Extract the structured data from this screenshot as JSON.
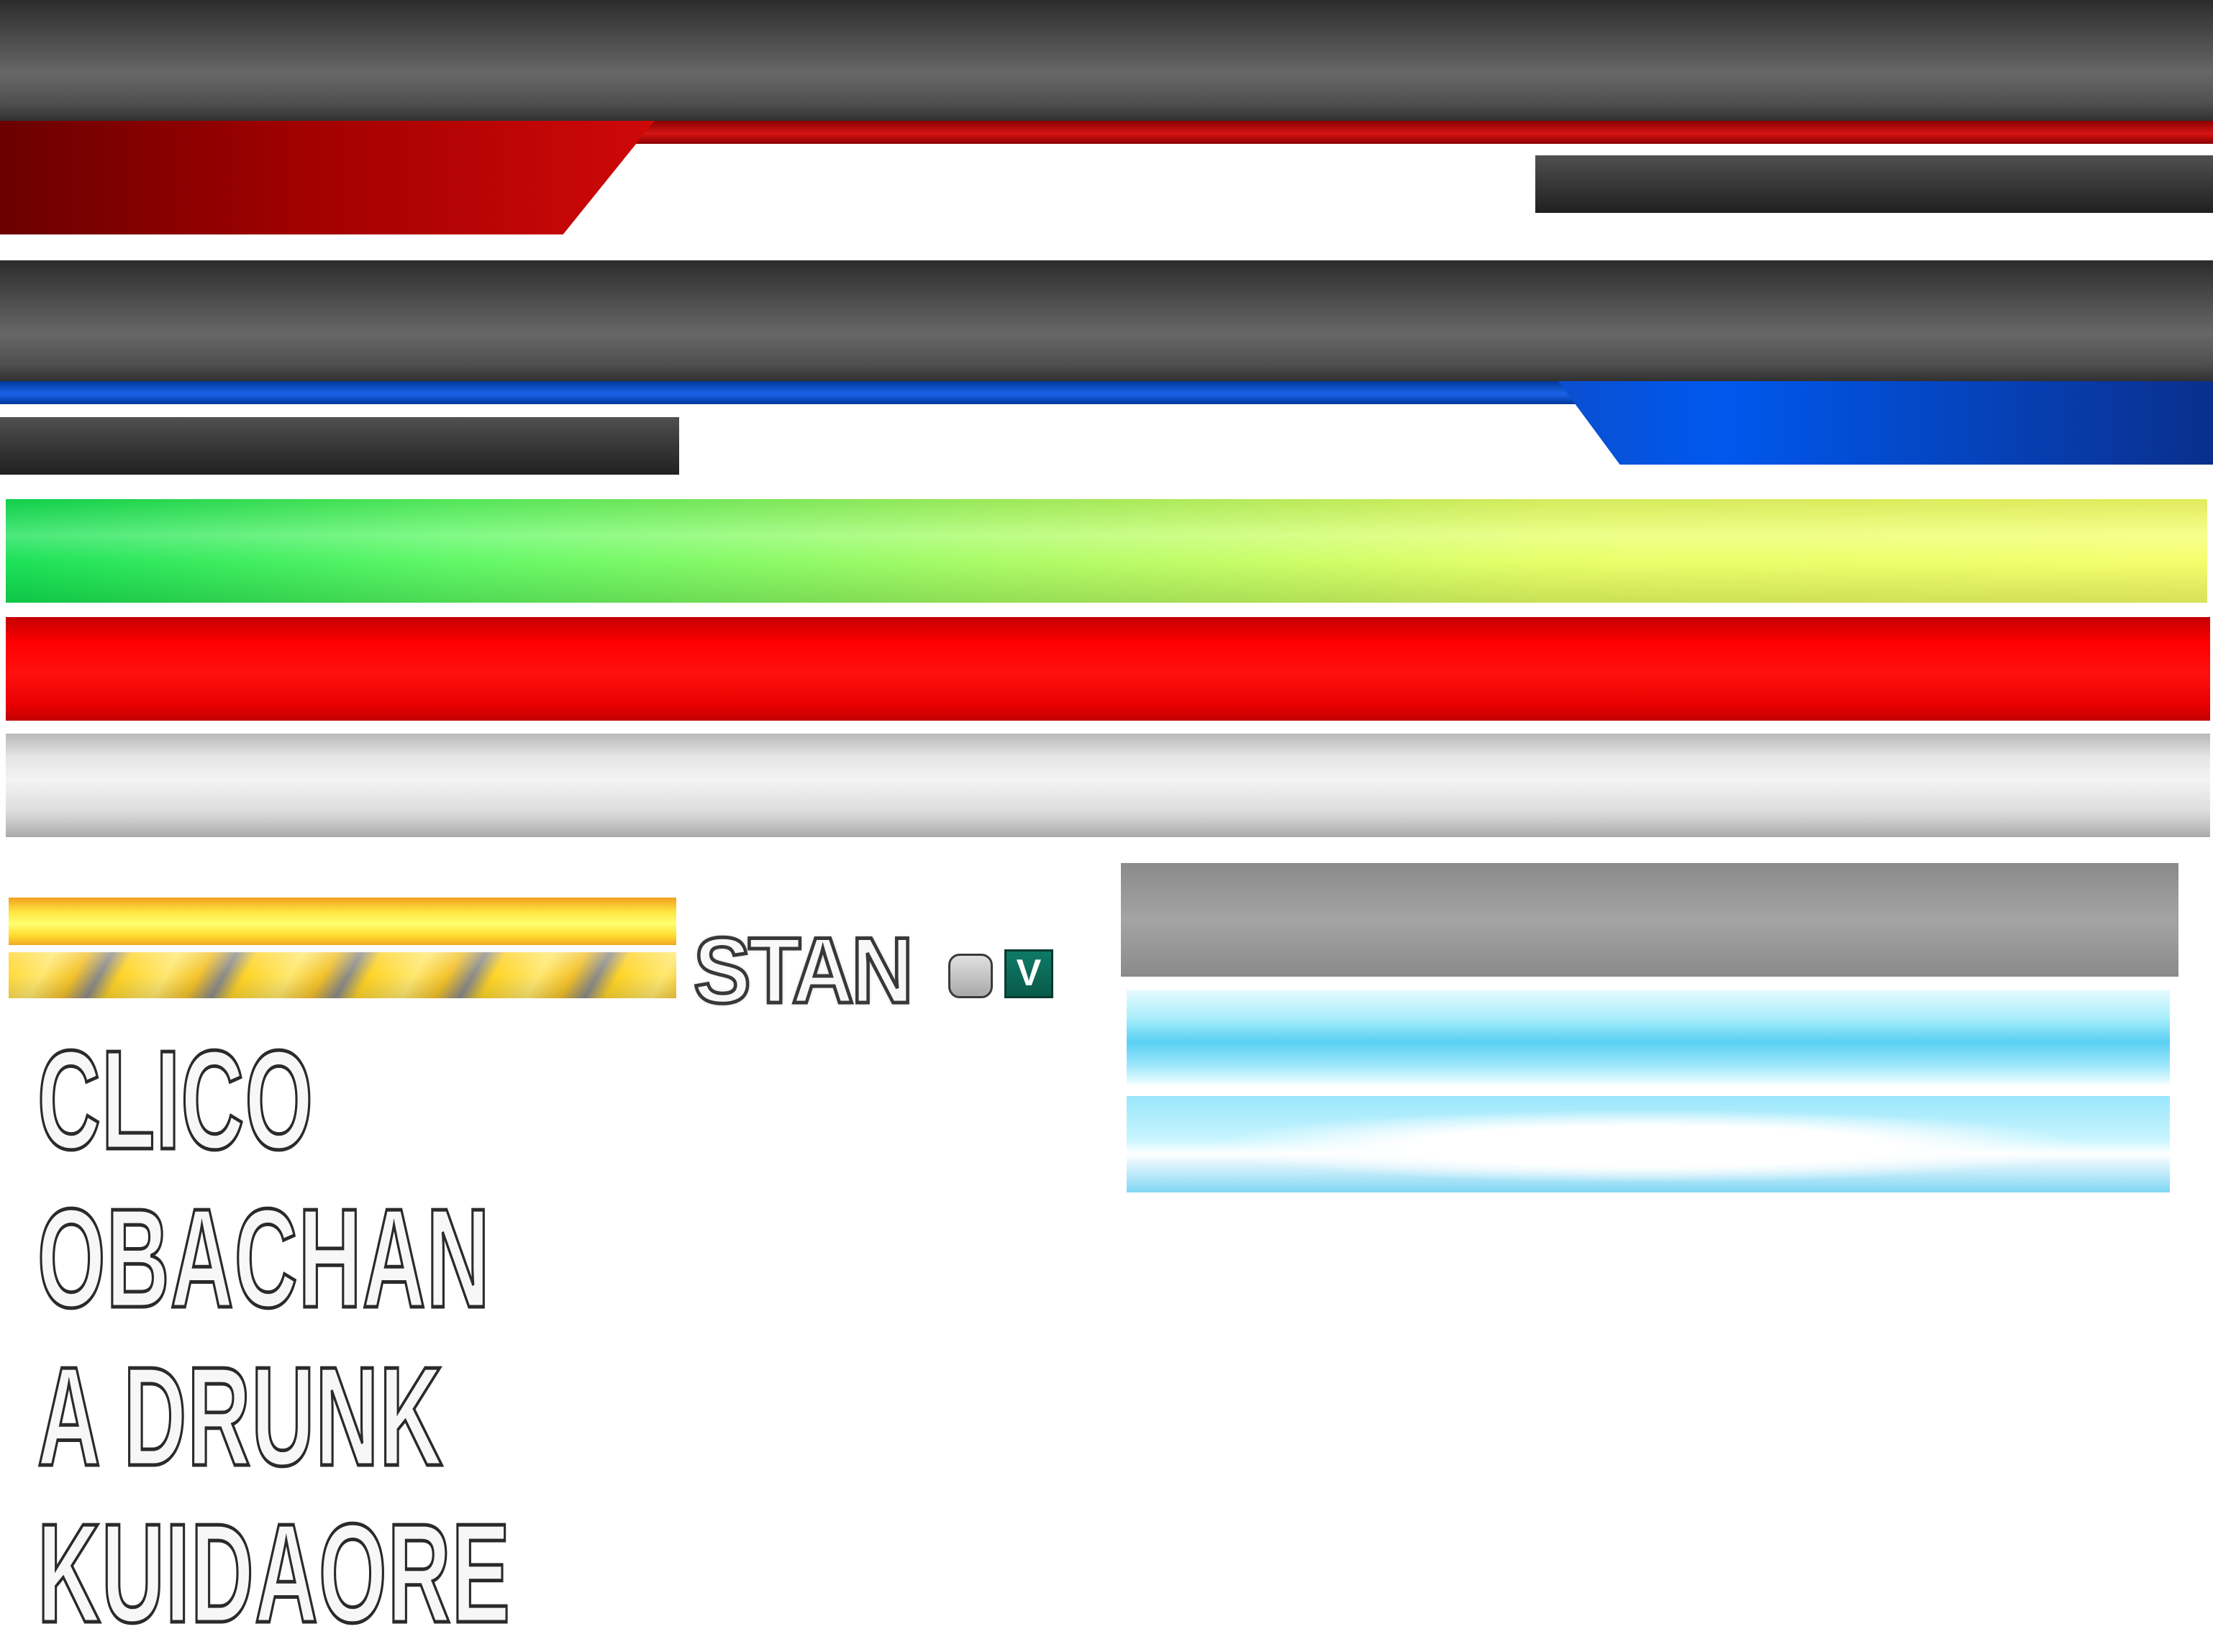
{
  "stan_logo": {
    "word": "STAN",
    "badge": "V",
    "colors": {
      "fill": "#f8f8f8",
      "outline": "#383838",
      "badge": "#0e7a66",
      "dot": "#b8b8b8"
    }
  },
  "character_names": [
    "CLICO",
    "OBACHAN",
    "A DRUNK",
    "KUIDAORE"
  ],
  "colors": {
    "player1": "#d41515",
    "player2": "#0058ee",
    "hud_dark": "#4a4a4a",
    "health_start": "#10e050",
    "health_end": "#f4ff66",
    "damage": "#ff0000",
    "empty": "#e4e4e4",
    "meter": "#ffe640",
    "charge": "#5ad0f4"
  }
}
